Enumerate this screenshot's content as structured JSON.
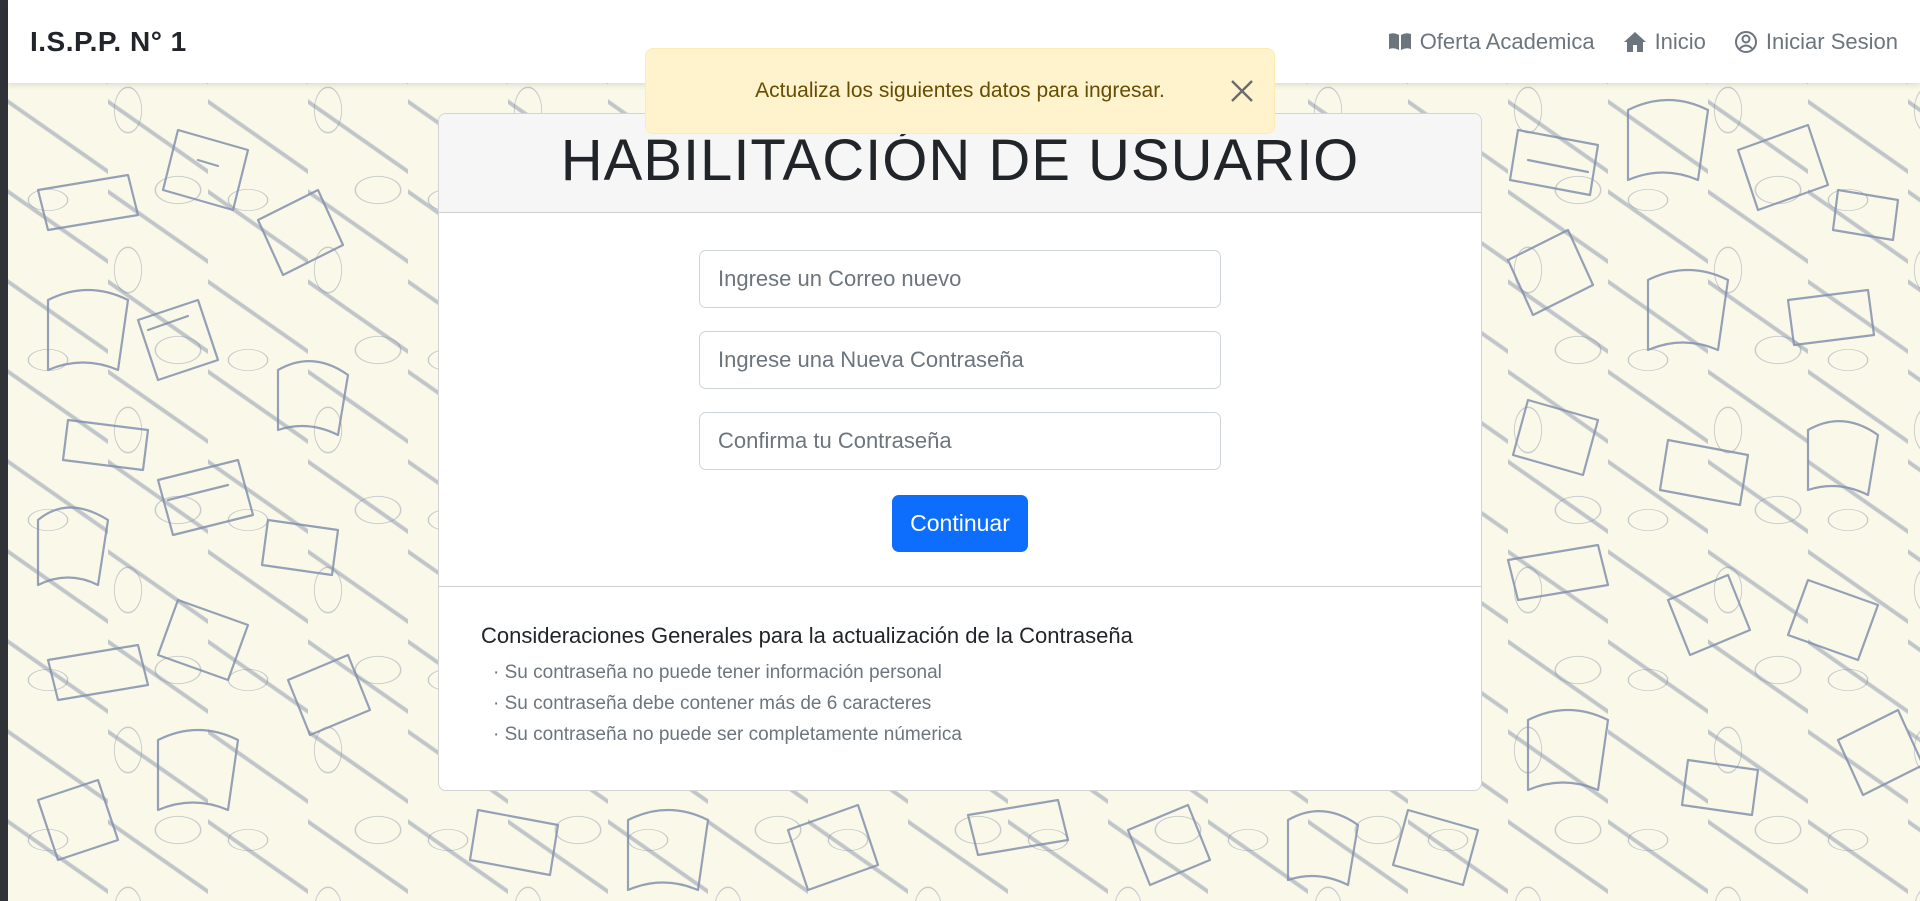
{
  "navbar": {
    "brand": "I.S.P.P. N° 1",
    "links": [
      {
        "label": "Oferta Academica",
        "icon": "book-icon"
      },
      {
        "label": "Inicio",
        "icon": "home-icon"
      },
      {
        "label": "Iniciar Sesion",
        "icon": "user-circle-icon"
      }
    ]
  },
  "alert": {
    "message": "Actualiza los siguientes datos para ingresar.",
    "close_icon": "close-icon",
    "color": "#fff3cd"
  },
  "card": {
    "title": "HABILITACIÓN DE USUARIO",
    "fields": [
      {
        "placeholder": "Ingrese un Correo nuevo",
        "value": ""
      },
      {
        "placeholder": "Ingrese una Nueva Contraseña",
        "value": ""
      },
      {
        "placeholder": "Confirma tu Contraseña",
        "value": ""
      }
    ],
    "submit_label": "Continuar",
    "submit_color": "#0d6efd"
  },
  "considerations": {
    "title": "Consideraciones Generales para la actualización de la Contraseña",
    "items": [
      "Su contraseña no puede tener información personal",
      "Su contraseña debe contener más de 6 caracteres",
      "Su contraseña no puede ser completamente númerica"
    ]
  }
}
